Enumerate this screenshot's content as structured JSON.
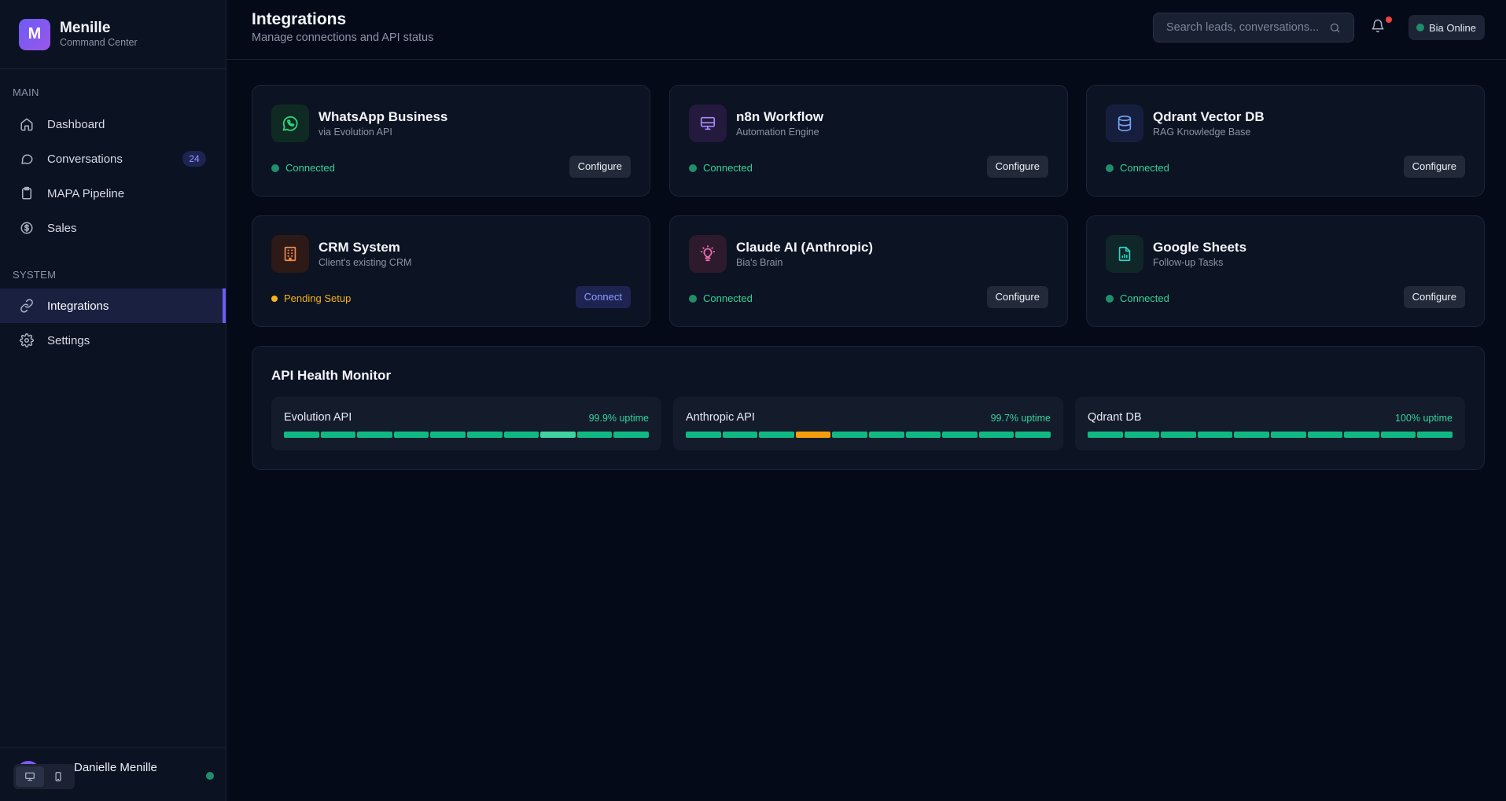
{
  "brand": {
    "initial": "M",
    "name": "Menille",
    "subtitle": "Command Center"
  },
  "nav": {
    "main_label": "MAIN",
    "system_label": "SYSTEM",
    "items": [
      {
        "label": "Dashboard",
        "icon": "home-icon"
      },
      {
        "label": "Conversations",
        "icon": "chat-icon",
        "badge": "24"
      },
      {
        "label": "MAPA Pipeline",
        "icon": "clipboard-icon"
      },
      {
        "label": "Sales",
        "icon": "dollar-icon"
      },
      {
        "label": "Integrations",
        "icon": "link-icon",
        "active": true
      },
      {
        "label": "Settings",
        "icon": "gear-icon"
      }
    ]
  },
  "user": {
    "name": "Danielle Menille",
    "status_color": "#1f8f6b"
  },
  "header": {
    "title": "Integrations",
    "subtitle": "Manage connections and API status",
    "search_placeholder": "Search leads, conversations...",
    "status_label": "Bia Online"
  },
  "integrations": [
    {
      "name": "WhatsApp Business",
      "sub": "via Evolution API",
      "status": "Connected",
      "action": "Configure",
      "icon": "whatsapp-icon"
    },
    {
      "name": "n8n Workflow",
      "sub": "Automation Engine",
      "status": "Connected",
      "action": "Configure",
      "icon": "monitor-icon"
    },
    {
      "name": "Qdrant Vector DB",
      "sub": "RAG Knowledge Base",
      "status": "Connected",
      "action": "Configure",
      "icon": "database-icon"
    },
    {
      "name": "CRM System",
      "sub": "Client's existing CRM",
      "status": "Pending Setup",
      "action": "Connect",
      "icon": "building-icon"
    },
    {
      "name": "Claude AI (Anthropic)",
      "sub": "Bia's Brain",
      "status": "Connected",
      "action": "Configure",
      "icon": "lightbulb-icon"
    },
    {
      "name": "Google Sheets",
      "sub": "Follow-up Tasks",
      "status": "Connected",
      "action": "Configure",
      "icon": "sheet-icon"
    }
  ],
  "colors": {
    "connected": "#1f8f6b",
    "connected_text": "#34d399",
    "pending": "#f5b21b",
    "accent": "#6d5cf6",
    "bar_ok": "#10b981",
    "bar_light": "#3fd3a0",
    "bar_warn": "#f59e0b"
  },
  "health": {
    "title": "API Health Monitor",
    "panels": [
      {
        "name": "Evolution API",
        "uptime": "99.9% uptime",
        "bars": [
          "ok",
          "ok",
          "ok",
          "ok",
          "ok",
          "ok",
          "ok",
          "light",
          "ok",
          "ok"
        ]
      },
      {
        "name": "Anthropic API",
        "uptime": "99.7% uptime",
        "bars": [
          "ok",
          "ok",
          "ok",
          "warn",
          "ok",
          "ok",
          "ok",
          "ok",
          "ok",
          "ok"
        ]
      },
      {
        "name": "Qdrant DB",
        "uptime": "100% uptime",
        "bars": [
          "ok",
          "ok",
          "ok",
          "ok",
          "ok",
          "ok",
          "ok",
          "ok",
          "ok",
          "ok"
        ]
      }
    ]
  }
}
